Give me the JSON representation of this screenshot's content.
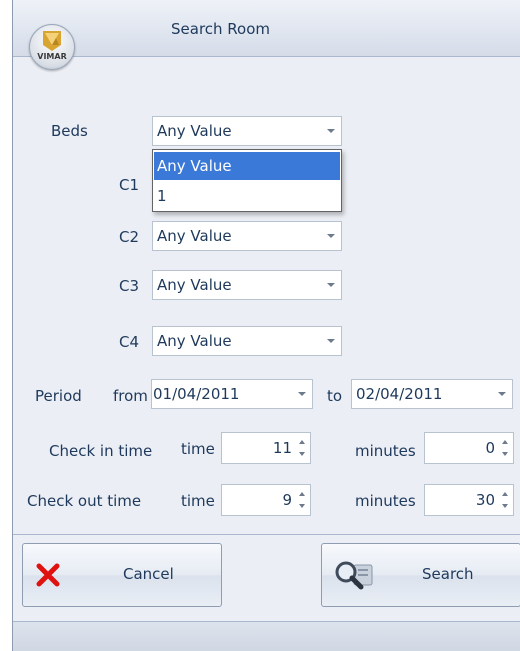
{
  "window": {
    "title": "Search Room",
    "logo_text": "VIMAR"
  },
  "form": {
    "beds_label": "Beds",
    "beds_value": "Any Value",
    "beds_options": [
      "Any Value",
      "1"
    ],
    "c1_label": "C1",
    "c2_label": "C2",
    "c2_value": "Any Value",
    "c3_label": "C3",
    "c3_value": "Any Value",
    "c4_label": "C4",
    "c4_value": "Any Value",
    "period_label": "Period",
    "from_label": "from",
    "from_value": "01/04/2011",
    "to_label": "to",
    "to_value": "02/04/2011",
    "checkin_label": "Check in time",
    "checkin_time_label": "time",
    "checkin_time_value": "11",
    "checkin_minutes_label": "minutes",
    "checkin_minutes_value": "0",
    "checkout_label": "Check out time",
    "checkout_time_label": "time",
    "checkout_time_value": "9",
    "checkout_minutes_label": "minutes",
    "checkout_minutes_value": "30"
  },
  "buttons": {
    "cancel_label": "Cancel",
    "search_label": "Search"
  },
  "icons": {
    "logo": "vimar-logo-icon",
    "cancel": "red-x-icon",
    "search": "magnifier-icon"
  },
  "colors": {
    "selection": "#3b79d8",
    "cancel_icon": "#e0120f"
  }
}
